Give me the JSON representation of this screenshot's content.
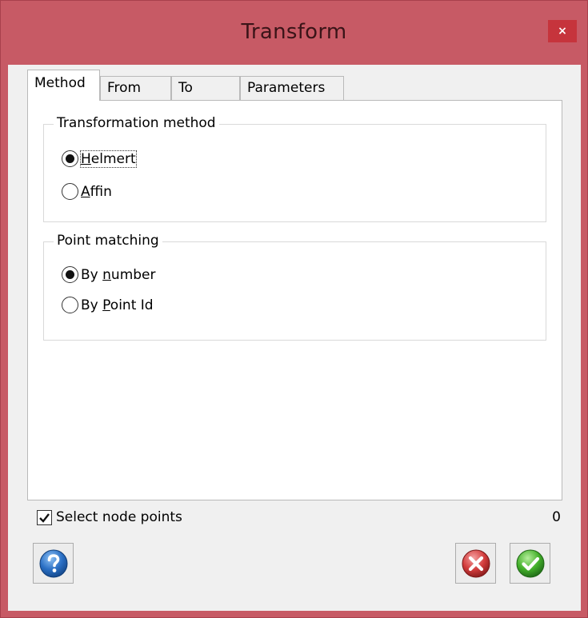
{
  "window": {
    "title": "Transform",
    "close_label": "×"
  },
  "tabs": [
    {
      "label": "Method",
      "active": true
    },
    {
      "label": "From",
      "active": false
    },
    {
      "label": "To",
      "active": false
    },
    {
      "label": "Parameters",
      "active": false
    }
  ],
  "transformation_method": {
    "legend": "Transformation method",
    "options": [
      {
        "label_rest": "elmert",
        "mnemonic": "H",
        "checked": true
      },
      {
        "label_rest": "ffin",
        "mnemonic": "A",
        "checked": false
      }
    ]
  },
  "point_matching": {
    "legend": "Point matching",
    "options": [
      {
        "prefix": "By ",
        "mnemonic": "n",
        "label_rest": "umber",
        "checked": true
      },
      {
        "prefix": "By ",
        "mnemonic": "P",
        "label_rest": "oint Id",
        "checked": false
      }
    ]
  },
  "footer": {
    "select_node_points_label": "Select node points",
    "select_node_points_checked": true,
    "count": "0"
  },
  "buttons": {
    "help_icon": "help-icon",
    "cancel_icon": "cancel-icon",
    "ok_icon": "ok-icon"
  },
  "colors": {
    "titlebar": "#c75a65",
    "close": "#c6343c",
    "help_blue": "#2a6fc4",
    "cancel_red": "#d23c3c",
    "ok_green": "#43b02a"
  }
}
